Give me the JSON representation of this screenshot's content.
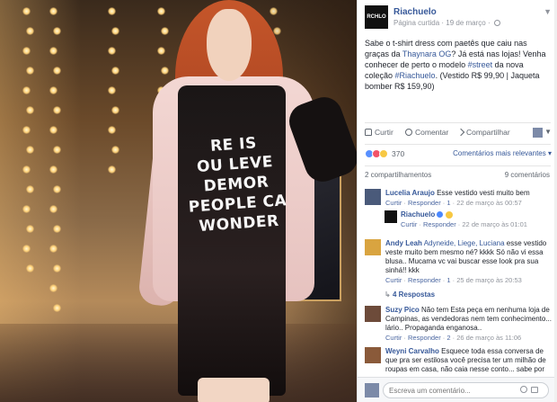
{
  "page": {
    "name": "Riachuelo",
    "avatar_text": "RCHLO",
    "meta_label": "Página curtida",
    "date": "19 de março"
  },
  "photo": {
    "dress_lines": [
      "RE IS",
      "OU LEVE",
      "DEMOR",
      "PEOPLE CA",
      "WONDER"
    ]
  },
  "post": {
    "text_parts": [
      "Sabe o t-shirt dress com paetês que caiu nas graças da ",
      "Thaynara OG",
      "? Já está nas lojas! Venha conhecer de perto o modelo ",
      "#street",
      " da nova coleção ",
      "#Riachuelo",
      ". (Vestido R$ 99,90 | Jaqueta bomber R$ 159,90)"
    ]
  },
  "actions": {
    "like": "Curtir",
    "comment": "Comentar",
    "share": "Compartilhar"
  },
  "reactions": {
    "count": "370",
    "sort_label": "Comentários mais relevantes",
    "colors": [
      "#5890ff",
      "#f25268",
      "#f7c843"
    ]
  },
  "stats": {
    "shares": "2 compartilhamentos",
    "comments": "9 comentários"
  },
  "comments": [
    {
      "name": "Lucelia Araujo",
      "text": "Esse vestido vesti muito bem",
      "like": "Curtir",
      "reply": "Responder",
      "likes": "1",
      "time": "22 de março às 00:57",
      "avatar_color": "#4a5a7a"
    },
    {
      "name": "Riachuelo",
      "text": "",
      "like": "Curtir",
      "reply": "Responder",
      "time": "22 de março às 01:01",
      "avatar_color": "#111111"
    },
    {
      "name": "Andy Leah",
      "tags": "Adyneide, Liege, Luciana",
      "text": "esse vestido veste muito bem mesmo né? kkkk Só não vi essa blusa.. Mucama vc vai buscar esse look pra sua sinhá!! kkk",
      "like": "Curtir",
      "reply": "Responder",
      "likes": "1",
      "time": "25 de março às 20:53",
      "avatar_color": "#d9a440"
    },
    {
      "name": "Suzy Pico",
      "text": "Não tem Esta peça em  nenhuma loja de Campinas, as vendedoras nem tem conhecimento... lário.. Propaganda enganosa..",
      "like": "Curtir",
      "reply": "Responder",
      "likes": "2",
      "time": "26 de março às 11:06",
      "avatar_color": "#6d4b3a"
    },
    {
      "name": "Weyni Carvalho",
      "text": "Esquece toda essa conversa de que pra ser estilosa você precisa ter um milhão de roupas em casa, não caia nesse conto... sabe por",
      "avatar_color": "#8a5a3a"
    }
  ],
  "replies_link": "4 Respostas",
  "composer": {
    "placeholder": "Escreva um comentário..."
  }
}
